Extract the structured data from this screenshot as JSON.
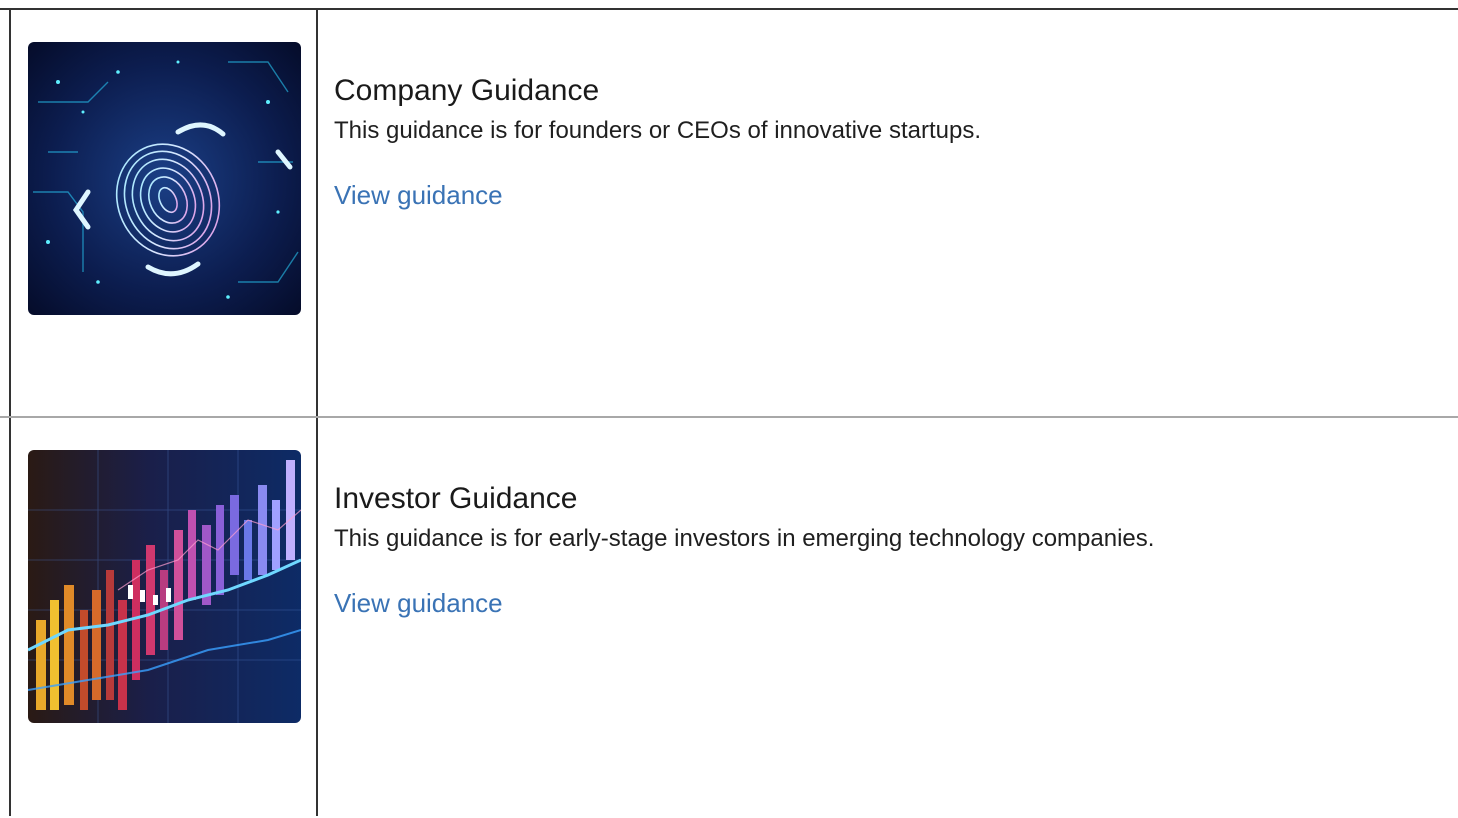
{
  "cards": [
    {
      "title": "Company Guidance",
      "description": "This guidance is for founders or CEOs of innovative startups.",
      "link_label": "View guidance",
      "image_icon": "fingerprint-icon"
    },
    {
      "title": "Investor Guidance",
      "description": "This guidance is for early-stage investors in emerging technology companies.",
      "link_label": "View guidance",
      "image_icon": "stock-chart-icon"
    }
  ],
  "colors": {
    "link": "#3a73b5",
    "text": "#1a1a1a",
    "border": "#333333",
    "divider": "#a8a8a8"
  }
}
